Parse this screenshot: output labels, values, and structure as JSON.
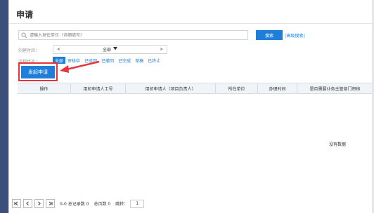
{
  "page": {
    "title": "申请"
  },
  "search": {
    "placeholder": "请输入发往单位（详细填写）",
    "button_label": "搜索",
    "advanced_label": "[高级搜索]"
  },
  "filters": {
    "date_label": "创建时间：",
    "date_prev": "<",
    "date_value": "全部",
    "date_next": ">",
    "status_label": "流程状态：",
    "statuses": [
      "全部",
      "审核中",
      "已驳回",
      "已撤回",
      "已完成",
      "草稿",
      "已终止"
    ]
  },
  "actions": {
    "launch_label": "发起申请"
  },
  "table": {
    "columns": [
      "操作",
      "用印申请人工号",
      "用印申请人（项目负责人）",
      "所在单位",
      "办理时间",
      "是否需要业务主管部门审核"
    ],
    "empty_text": "没有数据"
  },
  "pager": {
    "summary": "0-0 总记录数 0",
    "total_pages": "总页数 0",
    "jump_label": "跳转：",
    "jump_value": "1"
  },
  "colors": {
    "primary": "#1f7fd8",
    "highlight": "#e8333a",
    "sidebar": "#3b4f7a"
  }
}
